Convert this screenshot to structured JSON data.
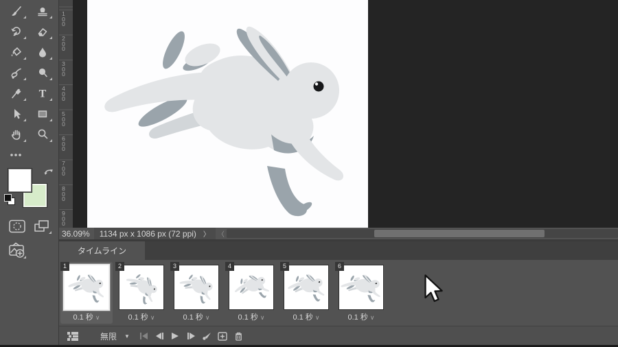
{
  "toolbar": {
    "tools": [
      "brush-tool",
      "clone-stamp-tool",
      "history-brush-tool",
      "eraser-tool",
      "paint-bucket-tool",
      "blur-tool",
      "smudge-tool",
      "dodge-tool",
      "pen-tool",
      "type-tool",
      "path-selection-tool",
      "rectangle-tool",
      "hand-tool",
      "zoom-tool",
      "edit-toolbar-ellipsis",
      "quick-mask-button",
      "screen-mode-button",
      "add-photo-button"
    ],
    "foreground_color": "#ffffff",
    "background_color": "#d7ecca"
  },
  "ruler": {
    "labels": [
      "100",
      "200",
      "300",
      "400",
      "500",
      "600",
      "700",
      "800",
      "900"
    ]
  },
  "statusbar": {
    "zoom_level": "36.09%",
    "doc_info": "1134 px x 1086 px (72 ppi)"
  },
  "icons": {
    "doc_expand": "〉",
    "scroll_left": "〈",
    "loop_caret": "▼",
    "duration_chevron": "∨"
  },
  "timeline": {
    "tab_label": "タイムライン",
    "loop_option": "無限",
    "frames": [
      {
        "number": "1",
        "duration": "0.1 秒"
      },
      {
        "number": "2",
        "duration": "0.1 秒"
      },
      {
        "number": "3",
        "duration": "0.1 秒"
      },
      {
        "number": "4",
        "duration": "0.1 秒"
      },
      {
        "number": "5",
        "duration": "0.1 秒"
      },
      {
        "number": "6",
        "duration": "0.1 秒"
      }
    ],
    "controls": [
      "convert-to-video-timeline",
      "loop-selector",
      "first-frame",
      "previous-frame",
      "play",
      "next-frame",
      "tween",
      "new-frame",
      "delete-frame"
    ]
  },
  "colors": {
    "panel_bg": "#525252",
    "pasteboard": "#242424",
    "canvas": "#fdfdfe",
    "rabbit_body": "#e3e5e7",
    "rabbit_accent": "#9aa4ab"
  }
}
